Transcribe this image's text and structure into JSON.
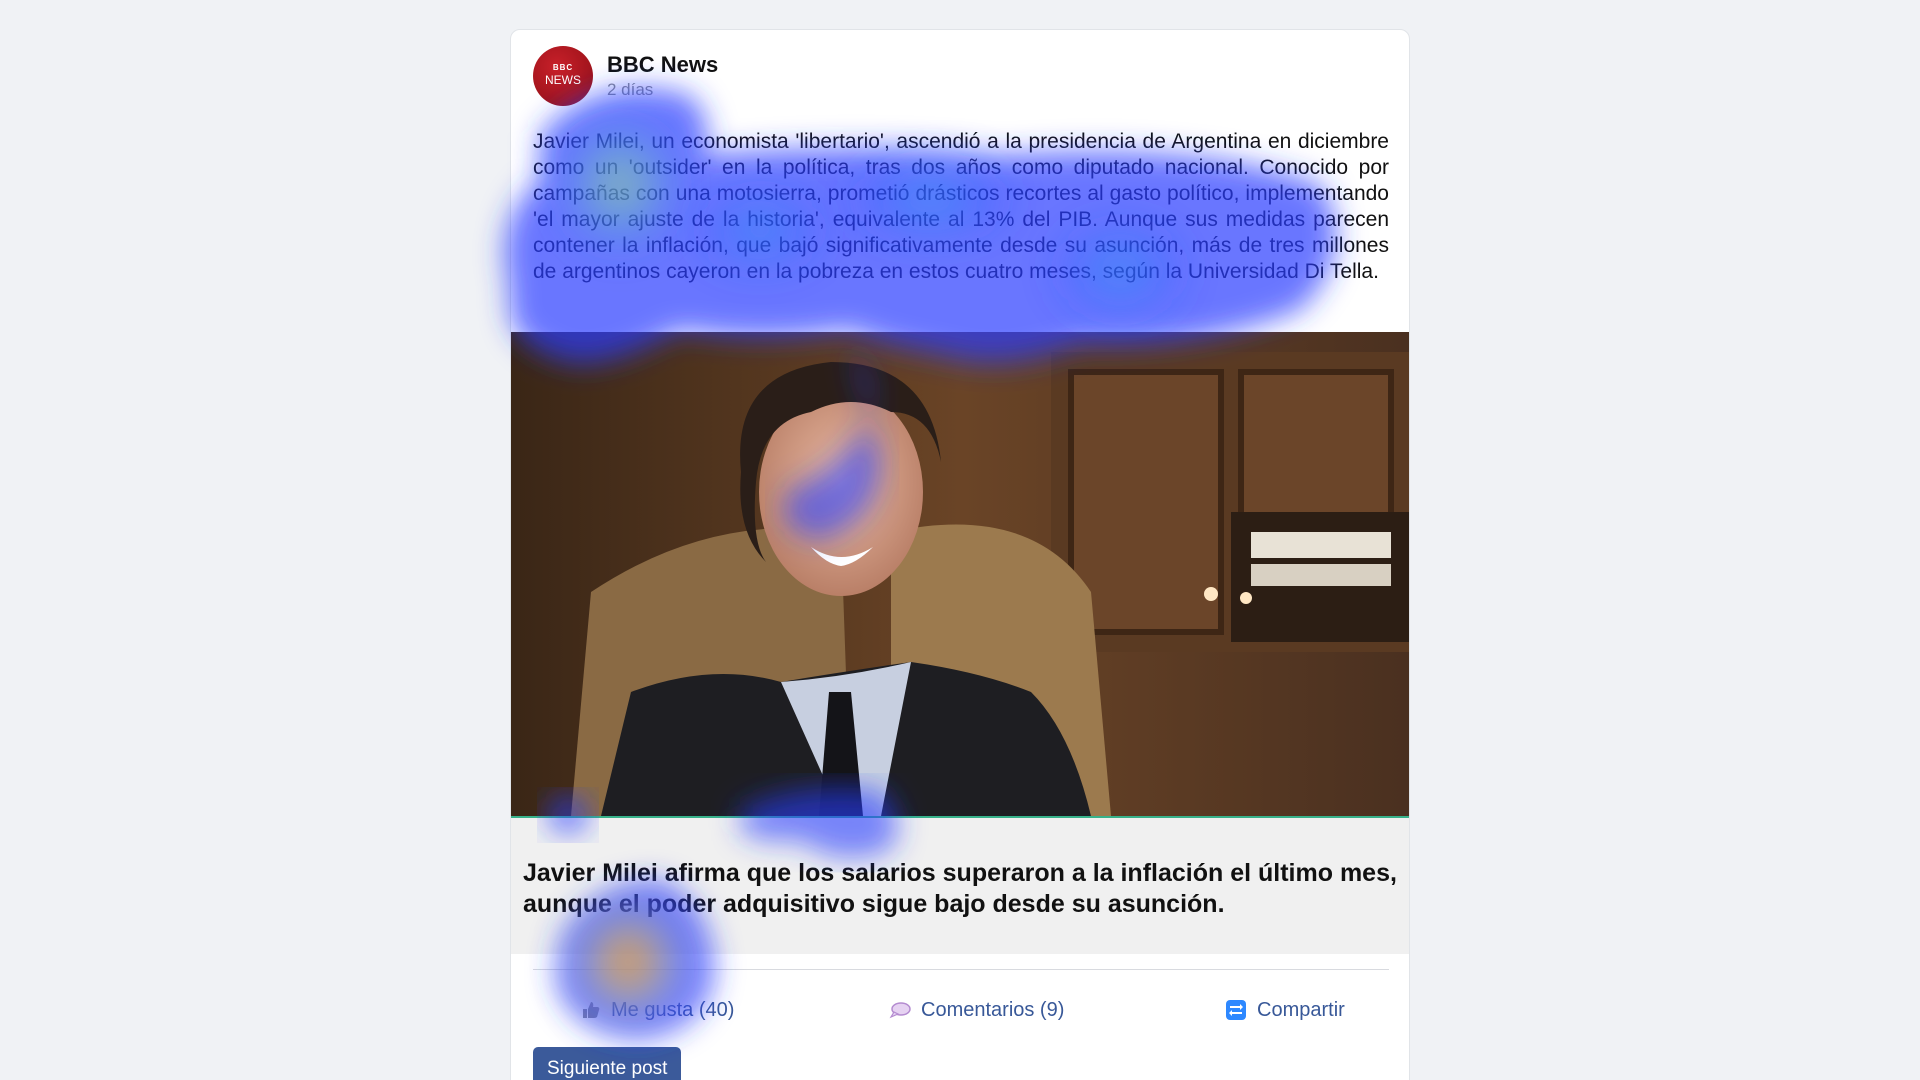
{
  "post": {
    "publisher": "BBC News",
    "avatar_logo_top": "BBC",
    "avatar_logo_bottom": "NEWS",
    "time": "2 días",
    "body": "Javier Milei, un economista 'libertario', ascendió a la presidencia de Argentina en diciembre como un 'outsider' en la política, tras dos años como diputado nacional. Conocido por campañas con una motosierra, prometió drásticos recortes al gasto político, implementando 'el mayor ajuste de la historia', equivalente al 13% del PIB. Aunque sus medidas parecen contener la inflación, que bajó significativamente desde su asunción, más de tres millones de argentinos cayeron en la pobreza en estos cuatro meses, según la Universidad Di Tella.",
    "image_icon": "photo-of-javier-milei",
    "headline": "Javier Milei afirma que los salarios superaron a la inflación el último mes, aunque el poder adquisitivo sigue bajo desde su asunción."
  },
  "actions": {
    "like_label": "Me gusta (40)",
    "comment_label": "Comentarios (9)",
    "share_label": "Compartir"
  },
  "footer": {
    "next_label": "Siguiente post"
  },
  "colors": {
    "background": "#f0f2f5",
    "link_blue": "#385898",
    "button_blue": "#3b5a9a",
    "bbc_red": "#b80f17",
    "preview_bg": "#f0f0f0"
  },
  "overlay": {
    "type": "eye-tracking attention heatmap",
    "colormap": "jet (blue → cyan → yellow → red)"
  }
}
